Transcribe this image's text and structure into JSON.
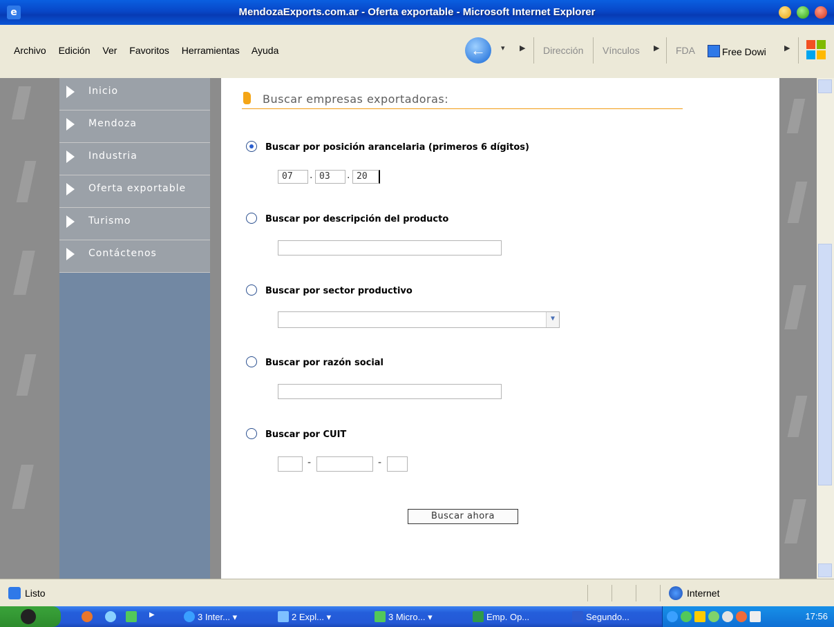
{
  "window": {
    "title": "MendozaExports.com.ar - Oferta exportable - Microsoft Internet Explorer"
  },
  "menu": [
    "Archivo",
    "Edición",
    "Ver",
    "Favoritos",
    "Herramientas",
    "Ayuda"
  ],
  "toolbar": {
    "address_label": "Dirección",
    "links_label": "Vínculos",
    "link_fda": "FDA",
    "link_free": "Free Dowi"
  },
  "sidebar": {
    "items": [
      {
        "label": "Inicio"
      },
      {
        "label": "Mendoza"
      },
      {
        "label": "Industria"
      },
      {
        "label": "Oferta exportable"
      },
      {
        "label": "Turismo"
      },
      {
        "label": "Contáctenos"
      }
    ]
  },
  "main": {
    "heading": "Buscar empresas exportadoras:",
    "options": {
      "tariff": {
        "label": "Buscar por posición arancelaria (primeros 6 dígitos)",
        "selected": true,
        "fields": [
          "07",
          "03",
          "20"
        ],
        "separator": "."
      },
      "description": {
        "label": "Buscar por descripción del producto",
        "value": ""
      },
      "sector": {
        "label": "Buscar por sector productivo",
        "value": ""
      },
      "company": {
        "label": "Buscar por razón social",
        "value": ""
      },
      "cuit": {
        "label": "Buscar por CUIT",
        "separator": "-"
      }
    },
    "submit_label": "Buscar ahora"
  },
  "status": {
    "text": "Listo",
    "zone": "Internet"
  },
  "taskbar": {
    "items": [
      "3 Inter...",
      "2 Expl...",
      "3 Micro...",
      "Emp. Op...",
      "Segundo..."
    ],
    "clock": "17:56"
  },
  "colors": {
    "accent_orange": "#f29a11",
    "sidebar_bg": "#7288a3",
    "nav_item_bg": "#9ba1a8"
  }
}
